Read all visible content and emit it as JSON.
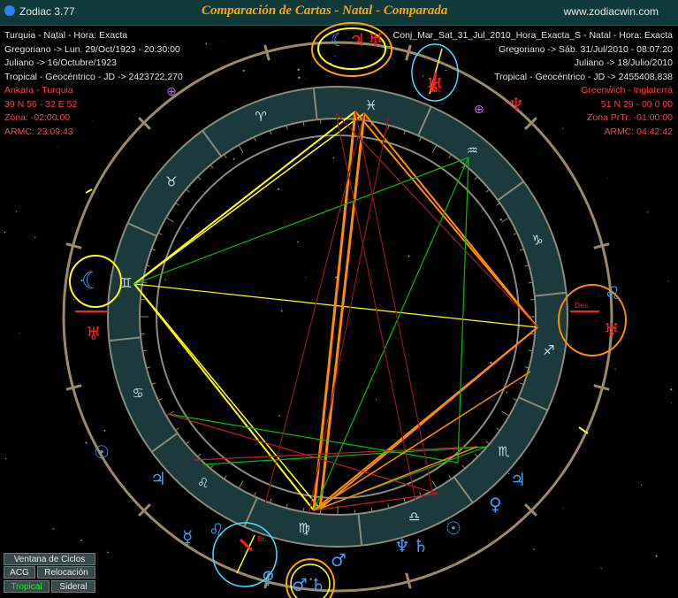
{
  "titlebar": {
    "app": "Zodiac 3.77",
    "title": "Comparación de Cartas  -  Natal - Comparada",
    "website": "www.zodiacwin.com"
  },
  "natal": {
    "line1": "Turquia - Natal - Hora: Exacta",
    "line2": "Gregoriano -> Lun. 29/Oct/1923 - 20:30:00",
    "line3": "Juliano -> 16/Octubre/1923",
    "line4": "Tropical - Geocéntrico - JD -> 2423722,270",
    "place": "Ankara - Turquia",
    "coords": "39 N 56 - 32 E 52",
    "zone": "Zóna: -02:00:00",
    "armc": "ARMC: 23:09:43"
  },
  "comparada": {
    "line1": "Conj_Mar_Sat_31_Jul_2010_Hora_Exacta_S - Natal - Hora: Exacta",
    "line2": "Gregoriano -> Sáb. 31/Jul/2010 - 08:07:20",
    "line3": "Juliano -> 18/Julio/2010",
    "line4": "Tropical - Geocéntrico - JD -> 2455408,838",
    "place": "Greenwich - Inglaterra",
    "coords": "51 N 29 - 00 0 00",
    "zone": "Zona PrTr: -01:00:00",
    "armc": "ARMC: 04:42:42"
  },
  "chart_labels": {
    "desc": "Des.",
    "mc": "Mc.",
    "bc": "Bc."
  },
  "zodiac_signs": [
    "♈",
    "♉",
    "♊",
    "♋",
    "♌",
    "♍",
    "♎",
    "♏",
    "♐",
    "♑",
    "♒",
    "♓"
  ],
  "glyphs": {
    "moon": "☾",
    "jupiter": "♃",
    "uranus": "♅",
    "mars": "♂",
    "saturn": "♄",
    "venus": "♀",
    "mercury": "☿",
    "neptune": "♆",
    "pluto": "♇",
    "sun": "☉",
    "part_fortune": "⊕"
  },
  "buttons": {
    "ventana": "Ventana de Ciclos",
    "acg": "ACG",
    "relocacion": "Relocación",
    "tropical": "Tropical",
    "sideral": "Sideral"
  },
  "colors": {
    "titlebar": "#103a3a",
    "title": "#ffa500",
    "ring": "#1c3a3c",
    "sign": "#bfe0e0",
    "planet_blue": "#3aa0ff",
    "planet_red": "#ff2020",
    "highlight_yellow": "#ffff00",
    "highlight_orange": "#ff8c00",
    "highlight_cyan": "#40e0ff"
  }
}
